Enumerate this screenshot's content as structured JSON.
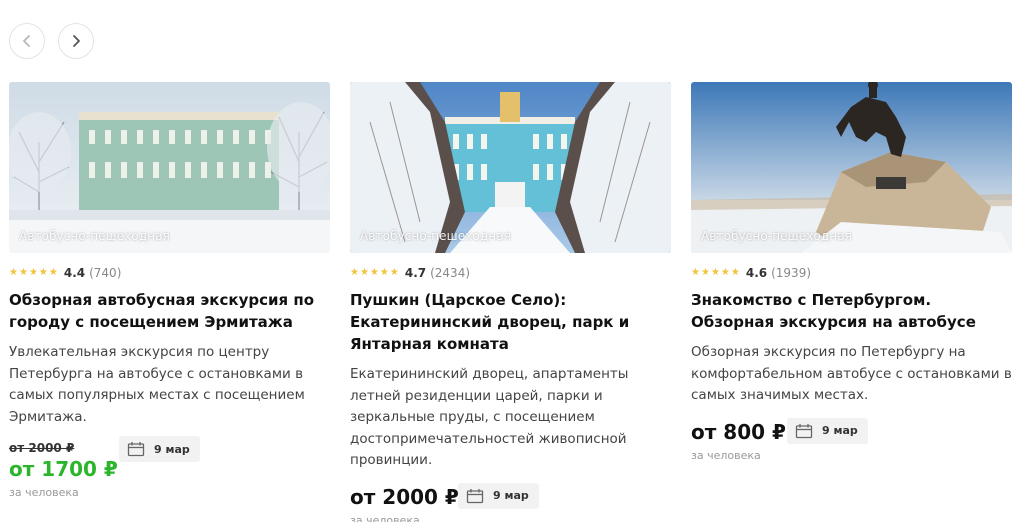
{
  "carousel": {
    "prev_label": "‹",
    "next_label": "›"
  },
  "cards": [
    {
      "photo_tag": "Автобусно-пешеходная",
      "rating": "4.4",
      "reviews": "(740)",
      "stars": 5,
      "title": "Обзорная автобусная экскурсия по городу с посещением Эрмитажа",
      "description": "Увлекательная экскурсия по центру Петербурга на автобусе с остановками в самых популярных местах с посещением Эрмитажа.",
      "old_price": "от 2000 ₽",
      "price": "от 1700 ₽",
      "per_person": "за человека",
      "date": "9 мар"
    },
    {
      "photo_tag": "Автобусно-пешеходная",
      "rating": "4.7",
      "reviews": "(2434)",
      "stars": 5,
      "title": "Пушкин (Царское Село): Екатерининский дворец, парк и Янтарная комната",
      "description": "Екатерининский дворец, апартаменты летней резиденции царей, парки и зеркальные пруды, с посещением достопримечательностей живописной провинции.",
      "price": "от 2000 ₽",
      "per_person": "за человека",
      "date": "9 мар"
    },
    {
      "photo_tag": "Автобусно-пешеходная",
      "rating": "4.6",
      "reviews": "(1939)",
      "stars": 5,
      "title": "Знакомство с Петербургом. Обзорная экскурсия на автобусе",
      "description": "Обзорная экскурсия по Петербургу на комфортабельном автобусе с остановками в самых значимых местах.",
      "price": "от 800 ₽",
      "per_person": "за человека",
      "date": "9 мар"
    }
  ],
  "colors": {
    "star": "#f2c33c",
    "discount_price": "#2bb52b"
  }
}
